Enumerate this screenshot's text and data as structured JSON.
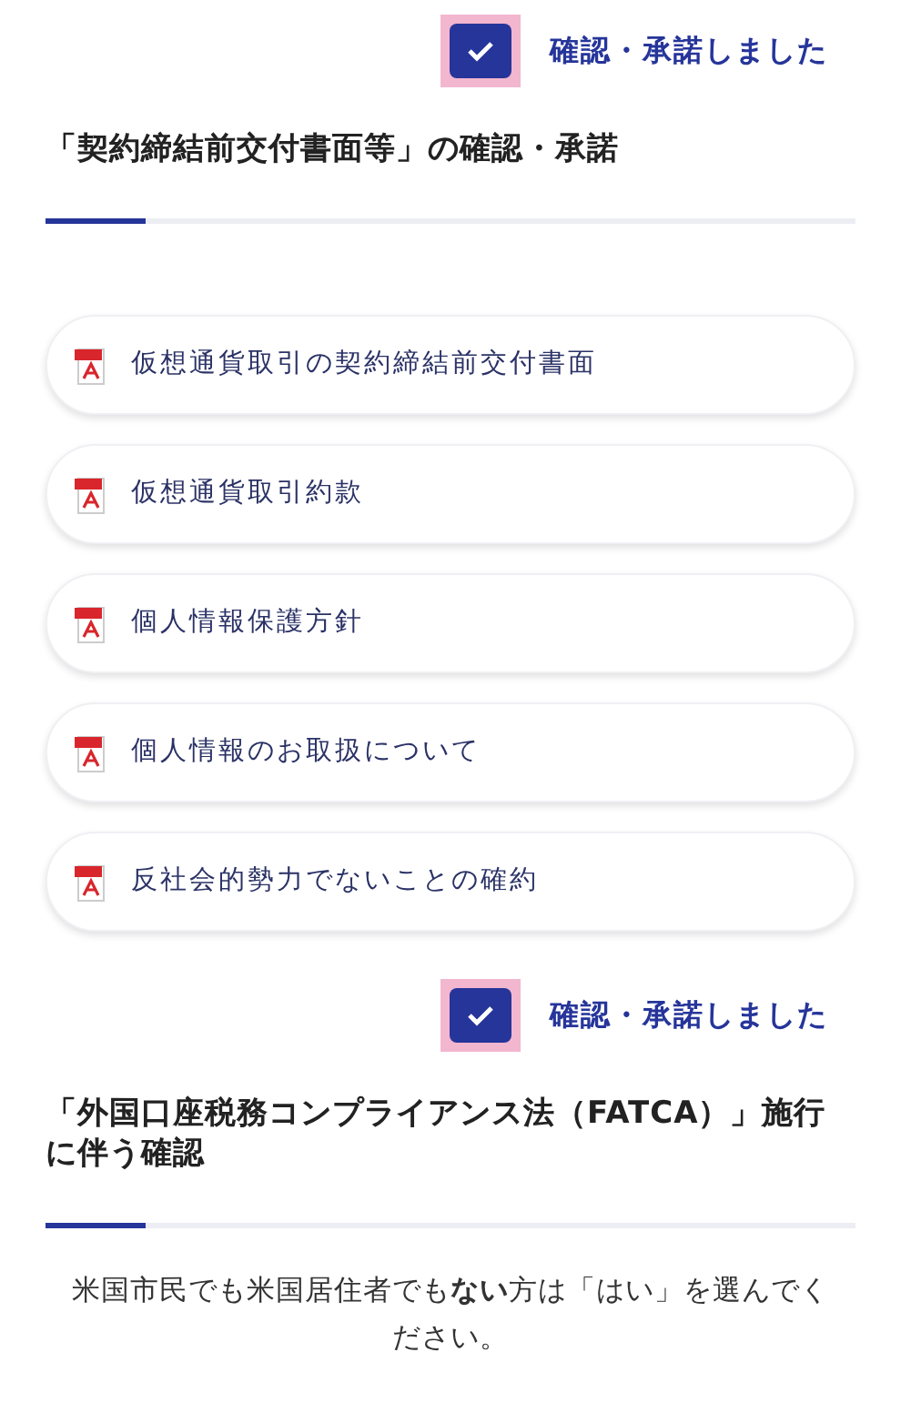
{
  "blocks": [
    {
      "kind": "confirm",
      "label": "確認・承諾しました",
      "checked": true
    },
    {
      "kind": "section",
      "title": "「契約締結前交付書面等」の確認・承諾",
      "documents": [
        {
          "label": "仮想通貨取引の契約締結前交付書面"
        },
        {
          "label": "仮想通貨取引約款"
        },
        {
          "label": "個人情報保護方針"
        },
        {
          "label": "個人情報のお取扱について"
        },
        {
          "label": "反社会的勢力でないことの確約"
        }
      ]
    },
    {
      "kind": "confirm",
      "label": "確認・承諾しました",
      "checked": true
    },
    {
      "kind": "section",
      "title": "「外国口座税務コンプライアンス法（FATCA）」施行に伴う確認",
      "text": "米国市民でも米国居住者でも**ない**方は「はい」を選んでください。"
    }
  ]
}
